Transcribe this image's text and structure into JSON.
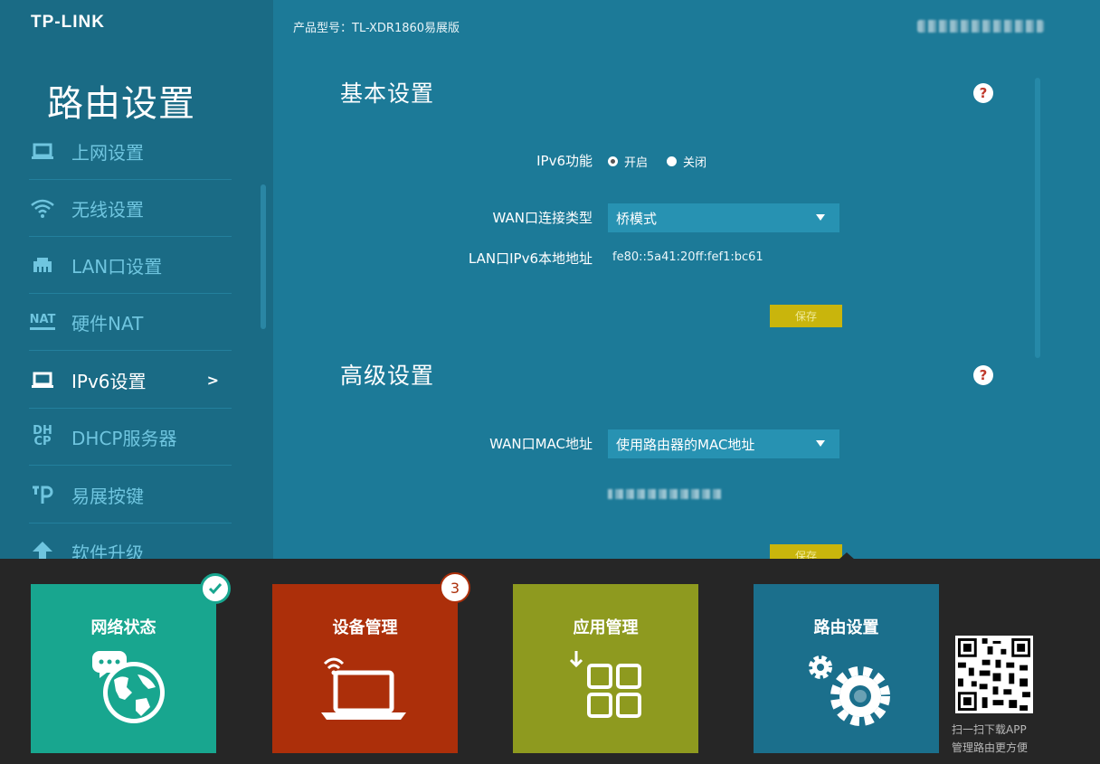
{
  "brand": {
    "logo": "TP-LINK"
  },
  "header": {
    "model": "产品型号：TL-XDR1860易展版"
  },
  "sidebar": {
    "title": "路由设置",
    "active_arrow": ">",
    "items": [
      {
        "label": "上网设置",
        "icon": "laptop-icon"
      },
      {
        "label": "无线设置",
        "icon": "wifi-icon"
      },
      {
        "label": "LAN口设置",
        "icon": "ethernet-icon"
      },
      {
        "label": "硬件NAT",
        "icon": "nat-icon",
        "icon_text": "NAT"
      },
      {
        "label": "IPv6设置",
        "icon": "laptop-icon",
        "active": true
      },
      {
        "label": "DHCP服务器",
        "icon": "dhcp-icon",
        "icon_text_top": "DH",
        "icon_text_bottom": "CP"
      },
      {
        "label": "易展按键",
        "icon": "easymesh-icon"
      },
      {
        "label": "软件升级",
        "icon": "upgrade-icon"
      }
    ]
  },
  "basic": {
    "title": "基本设置",
    "help": "?",
    "ipv6_label": "IPv6功能",
    "ipv6_on": "开启",
    "ipv6_off": "关闭",
    "ipv6_selected": "on",
    "wan_type_label": "WAN口连接类型",
    "wan_type_value": "桥模式",
    "lan_addr_label": "LAN口IPv6本地地址",
    "lan_addr_value": "fe80::5a41:20ff:fef1:bc61",
    "save": "保存"
  },
  "advanced": {
    "title": "高级设置",
    "help": "?",
    "mac_label": "WAN口MAC地址",
    "mac_value": "使用路由器的MAC地址",
    "save": "保存"
  },
  "tiles": [
    {
      "label": "网络状态",
      "color": "#18a68f",
      "badge_icon": "check-icon"
    },
    {
      "label": "设备管理",
      "color": "#ac2f0a",
      "badge": "3"
    },
    {
      "label": "应用管理",
      "color": "#8e9a1f"
    },
    {
      "label": "路由设置",
      "color": "#1b6f8c"
    }
  ],
  "qr": {
    "line1": "扫一扫下载APP",
    "line2": "管理路由更方便"
  }
}
